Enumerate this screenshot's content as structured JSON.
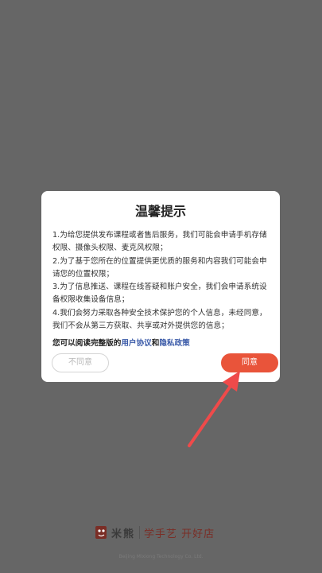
{
  "dialog": {
    "title": "温馨提示",
    "paragraphs": [
      "1.为给您提供发布课程或者售后服务，我们可能会申请手机存储权限、摄像头权限、麦克风权限；",
      "2.为了基于您所在的位置提供更优质的服务和内容我们可能会申请您的位置权限；",
      "3.为了信息推送、课程在线答疑和账户安全，我们会申请系统设备权限收集设备信息；",
      "4.我们会努力采取各种安全技术保护您的个人信息，未经同意，我们不会从第三方获取、共享或对外提供您的信息；"
    ],
    "policy_prefix": "您可以阅读完整版的",
    "user_agreement_link": "用户协议",
    "policy_conjunction": "和",
    "privacy_policy_link": "隐私政策",
    "disagree_label": "不同意",
    "agree_label": "同意"
  },
  "footer": {
    "brand_name": "米熊",
    "slogan": "学手艺 开好店",
    "company": "Beijing Mixiong Technology Co. Ltd."
  },
  "colors": {
    "overlay": "#666666",
    "accent": "#e9543a",
    "link": "#3a5aa8",
    "brand_dark": "#7a2e26"
  },
  "icons": {
    "annotation_arrow": "arrow-up-right",
    "brand_logo": "bear-logo"
  }
}
